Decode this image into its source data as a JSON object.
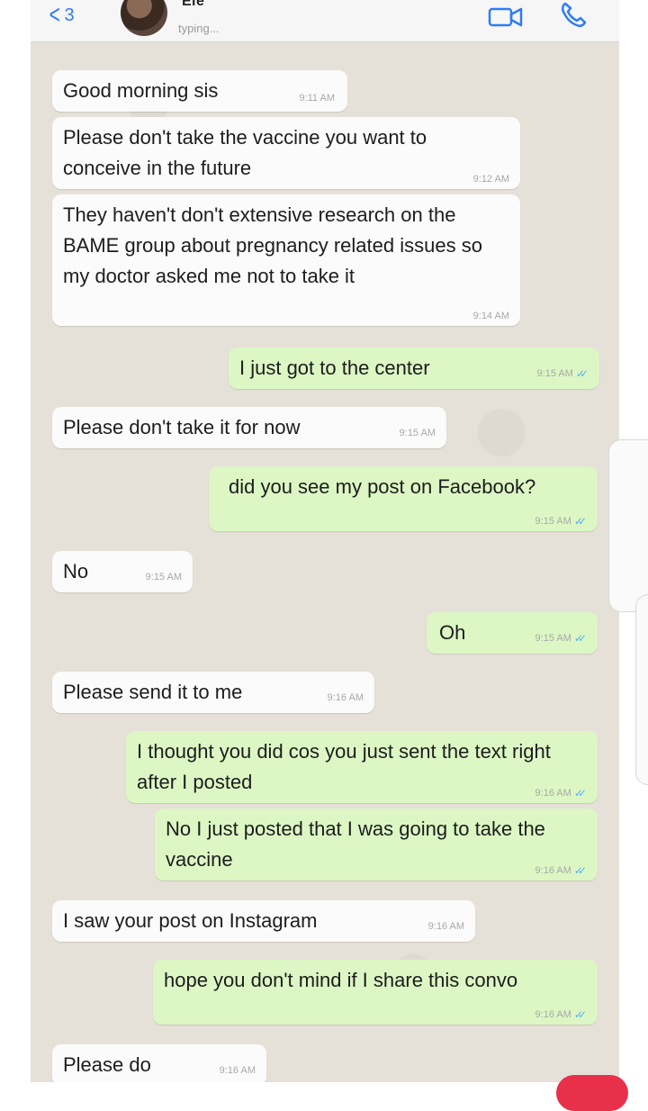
{
  "header": {
    "back_count": "3",
    "contact_name": "Efe",
    "status": "typing..."
  },
  "messages": [
    {
      "dir": "in",
      "text": "Good morning sis",
      "time": "9:11 AM"
    },
    {
      "dir": "in",
      "text": "Please don't take the vaccine you want to conceive in the future",
      "time": "9:12 AM"
    },
    {
      "dir": "in",
      "text": "They haven't don't extensive research on the BAME group about pregnancy related issues so my doctor asked me not to take it",
      "time": "9:14 AM"
    },
    {
      "dir": "out",
      "text": "I just got to the center",
      "time": "9:15 AM"
    },
    {
      "dir": "in",
      "text": "Please don't take it for now",
      "time": "9:15 AM"
    },
    {
      "dir": "out",
      "text": "did you see my post on Facebook?",
      "time": "9:15 AM"
    },
    {
      "dir": "in",
      "text": "No",
      "time": "9:15 AM"
    },
    {
      "dir": "out",
      "text": "Oh",
      "time": "9:15 AM"
    },
    {
      "dir": "in",
      "text": "Please send it to me",
      "time": "9:16 AM"
    },
    {
      "dir": "out",
      "text": "I thought you did cos you just sent the text right after I posted",
      "time": "9:16 AM"
    },
    {
      "dir": "out",
      "text": "No I just posted that I was going to take the vaccine",
      "time": "9:16 AM"
    },
    {
      "dir": "in",
      "text": "I saw your post on Instagram",
      "time": "9:16 AM"
    },
    {
      "dir": "out",
      "text": "hope you don't mind if I share this convo",
      "time": "9:16 AM"
    },
    {
      "dir": "in",
      "text": "Please do",
      "time": "9:16 AM"
    }
  ],
  "icons": {
    "back": "chevron-left-icon",
    "video": "video-camera-icon",
    "call": "phone-icon",
    "read_receipt": "double-check-icon"
  },
  "colors": {
    "accent": "#2f7cf6",
    "incoming_bubble": "#fbfbfb",
    "outgoing_bubble": "#dcf7c4",
    "chat_background": "#e6e1d8",
    "read_ticks": "#58b0f0"
  }
}
